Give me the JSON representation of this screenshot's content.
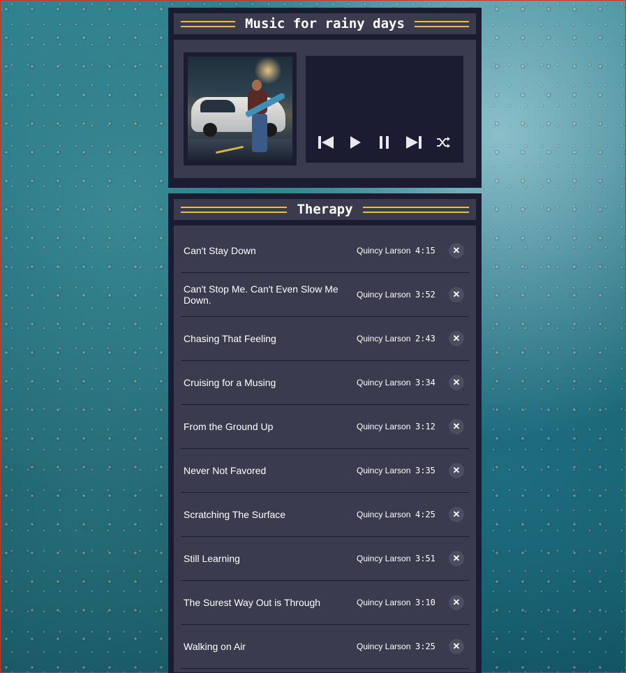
{
  "player": {
    "title": "Music for rainy days",
    "album_art_alt": "album art",
    "controls": {
      "previous": "previous",
      "play": "play",
      "pause": "pause",
      "next": "next",
      "shuffle": "shuffle"
    }
  },
  "playlist": {
    "title": "Therapy",
    "songs": [
      {
        "title": "Can't Stay Down",
        "artist": "Quincy Larson",
        "duration": "4:15"
      },
      {
        "title": "Can't Stop Me. Can't Even Slow Me Down.",
        "artist": "Quincy Larson",
        "duration": "3:52"
      },
      {
        "title": "Chasing That Feeling",
        "artist": "Quincy Larson",
        "duration": "2:43"
      },
      {
        "title": "Cruising for a Musing",
        "artist": "Quincy Larson",
        "duration": "3:34"
      },
      {
        "title": "From the Ground Up",
        "artist": "Quincy Larson",
        "duration": "3:12"
      },
      {
        "title": "Never Not Favored",
        "artist": "Quincy Larson",
        "duration": "3:35"
      },
      {
        "title": "Scratching The Surface",
        "artist": "Quincy Larson",
        "duration": "4:25"
      },
      {
        "title": "Still Learning",
        "artist": "Quincy Larson",
        "duration": "3:51"
      },
      {
        "title": "The Surest Way Out is Through",
        "artist": "Quincy Larson",
        "duration": "3:10"
      },
      {
        "title": "Walking on Air",
        "artist": "Quincy Larson",
        "duration": "3:25"
      }
    ],
    "delete_icon": "✕"
  },
  "colors": {
    "panel_dark": "#1b1b32",
    "panel": "#3b3b4f",
    "accent": "#f1be32",
    "text": "#ffffff"
  }
}
